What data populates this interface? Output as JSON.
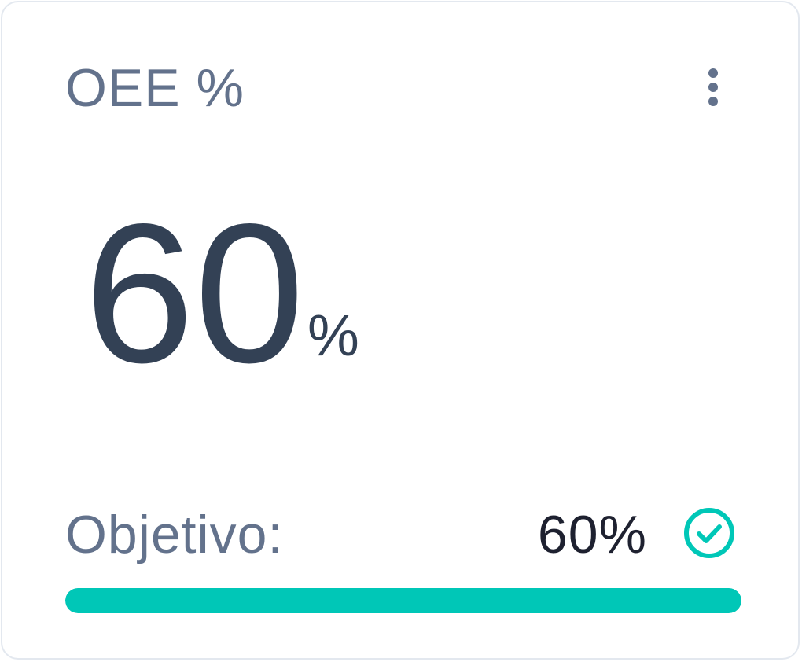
{
  "card": {
    "title": "OEE %",
    "value": "60",
    "unit": "%",
    "target_label": "Objetivo:",
    "target_value": "60%",
    "target_met": true,
    "progress_fraction": 1.0
  },
  "icons": {
    "menu": "more-vertical-icon",
    "status": "check-circle-icon"
  },
  "colors": {
    "accent": "#00c7b7",
    "title": "#63728c",
    "value": "#334155",
    "target_value": "#1e2130",
    "border": "#e3e8ef"
  }
}
